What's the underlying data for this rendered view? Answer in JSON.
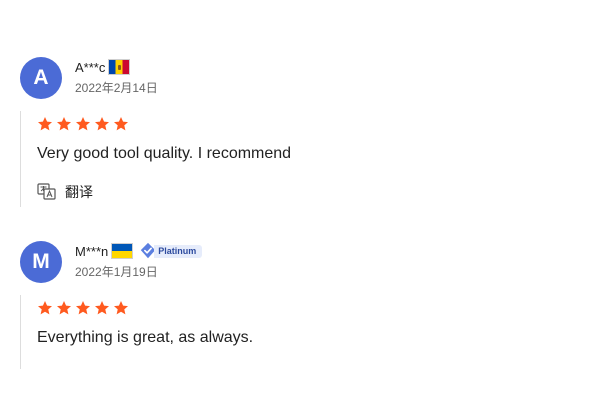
{
  "reviews": [
    {
      "avatar_initial": "A",
      "username": "A***c",
      "country_flag": "moldova-flag-icon",
      "date": "2022年2月14日",
      "rating": 5,
      "text": "Very good tool quality. I recommend",
      "translate_label": "翻译"
    },
    {
      "avatar_initial": "M",
      "username": "M***n",
      "country_flag": "ukraine-flag-icon",
      "badge": "Platinum",
      "date": "2022年1月19日",
      "rating": 5,
      "text": "Everything is great, as always."
    }
  ],
  "colors": {
    "avatar": "#4b6bd6",
    "star": "#ff5a1f",
    "badge_bg": "#e6ecfb",
    "badge_text": "#2c4a9e"
  }
}
